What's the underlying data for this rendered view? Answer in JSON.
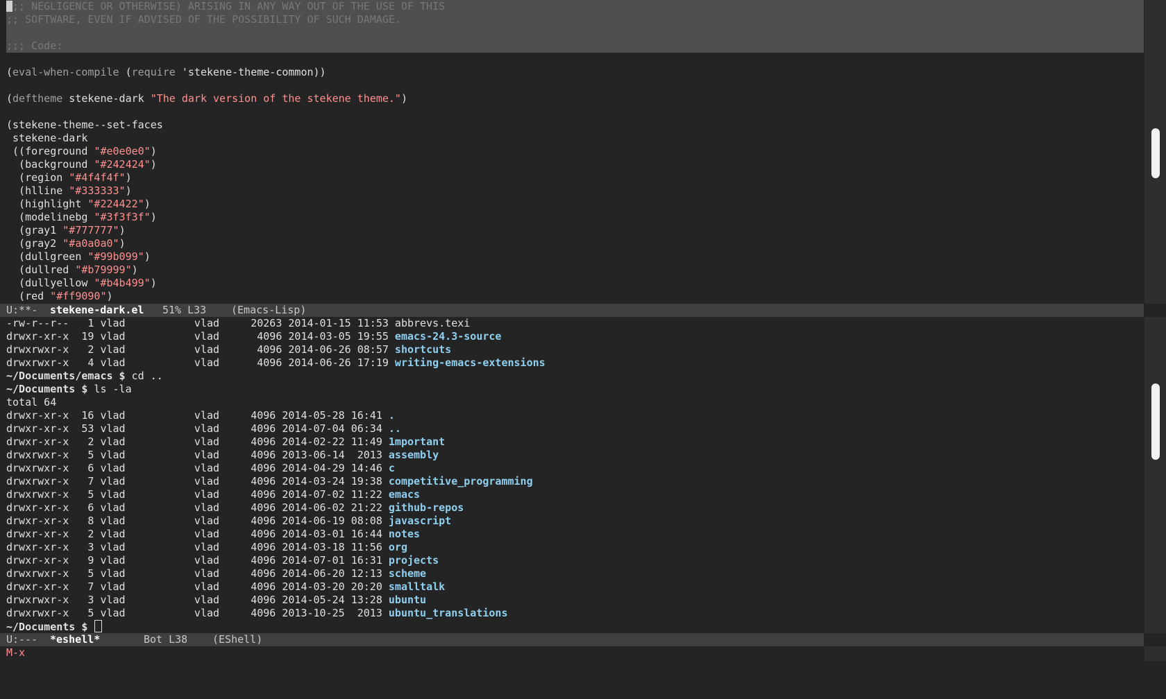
{
  "editor": {
    "comment_lines": [
      ";; NEGLIGENCE OR OTHERWISE) ARISING IN ANY WAY OUT OF THE USE OF THIS",
      ";; SOFTWARE, EVEN IF ADVISED OF THE POSSIBILITY OF SUCH DAMAGE.",
      "",
      ";;; Code:"
    ],
    "eval_line": {
      "pre": "(",
      "kw": "eval-when-compile",
      "mid": " (",
      "kw2": "require",
      "sym": " 'stekene-theme-common",
      "post": "))"
    },
    "deftheme_line": {
      "pre": "(",
      "kw": "deftheme",
      "name": " stekene-dark ",
      "str": "\"The dark version of the stekene theme.\"",
      "post": ")"
    },
    "setfaces_line": "(stekene-theme--set-faces",
    "theme_name_line": " stekene-dark",
    "faces": [
      {
        "prefix": " ((",
        "name": "foreground",
        "value": "\"#e0e0e0\"",
        "suffix": ")"
      },
      {
        "prefix": "  (",
        "name": "background",
        "value": "\"#242424\"",
        "suffix": ")"
      },
      {
        "prefix": "  (",
        "name": "region",
        "value": "\"#4f4f4f\"",
        "suffix": ")"
      },
      {
        "prefix": "  (",
        "name": "hlline",
        "value": "\"#333333\"",
        "suffix": ")"
      },
      {
        "prefix": "  (",
        "name": "highlight",
        "value": "\"#224422\"",
        "suffix": ")"
      },
      {
        "prefix": "  (",
        "name": "modelinebg",
        "value": "\"#3f3f3f\"",
        "suffix": ")"
      },
      {
        "prefix": "  (",
        "name": "gray1",
        "value": "\"#777777\"",
        "suffix": ")"
      },
      {
        "prefix": "  (",
        "name": "gray2",
        "value": "\"#a0a0a0\"",
        "suffix": ")"
      },
      {
        "prefix": "  (",
        "name": "dullgreen",
        "value": "\"#99b099\"",
        "suffix": ")"
      },
      {
        "prefix": "  (",
        "name": "dullred",
        "value": "\"#b79999\"",
        "suffix": ")"
      },
      {
        "prefix": "  (",
        "name": "dullyellow",
        "value": "\"#b4b499\"",
        "suffix": ")"
      },
      {
        "prefix": "  (",
        "name": "red",
        "value": "\"#ff9090\"",
        "suffix": ")"
      }
    ]
  },
  "modeline_top": {
    "status": "U:**-",
    "buffer": "stekene-dark.el",
    "pos": "51% L33",
    "mode": "(Emacs-Lisp)"
  },
  "shell": {
    "first_listing": [
      {
        "meta": "-rw-r--r--   1 vlad           vlad     20263 2014-01-15 11:53 ",
        "name": "abbrevs.texi",
        "dir": false
      },
      {
        "meta": "drwxr-xr-x  19 vlad           vlad      4096 2014-03-05 19:55 ",
        "name": "emacs-24.3-source",
        "dir": true
      },
      {
        "meta": "drwxrwxr-x   2 vlad           vlad      4096 2014-06-26 08:57 ",
        "name": "shortcuts",
        "dir": true
      },
      {
        "meta": "drwxrwxr-x   4 vlad           vlad      4096 2014-06-26 17:19 ",
        "name": "writing-emacs-extensions",
        "dir": true
      }
    ],
    "cmd1": {
      "prompt": "~/Documents/emacs $",
      "command": " cd .."
    },
    "cmd2": {
      "prompt": "~/Documents $",
      "command": " ls -la"
    },
    "total": "total 64",
    "second_listing": [
      {
        "meta": "drwxr-xr-x  16 vlad           vlad     4096 2014-05-28 16:41 ",
        "name": ".",
        "dir": true
      },
      {
        "meta": "drwxr-xr-x  53 vlad           vlad     4096 2014-07-04 06:34 ",
        "name": "..",
        "dir": true
      },
      {
        "meta": "drwxr-xr-x   2 vlad           vlad     4096 2014-02-22 11:49 ",
        "name": "1mportant",
        "dir": true
      },
      {
        "meta": "drwxrwxr-x   5 vlad           vlad     4096 2013-06-14  2013 ",
        "name": "assembly",
        "dir": true
      },
      {
        "meta": "drwxrwxr-x   6 vlad           vlad     4096 2014-04-29 14:46 ",
        "name": "c",
        "dir": true
      },
      {
        "meta": "drwxrwxr-x   7 vlad           vlad     4096 2014-03-24 19:38 ",
        "name": "competitive_programming",
        "dir": true
      },
      {
        "meta": "drwxrwxr-x   5 vlad           vlad     4096 2014-07-02 11:22 ",
        "name": "emacs",
        "dir": true
      },
      {
        "meta": "drwxr-xr-x   6 vlad           vlad     4096 2014-06-02 21:22 ",
        "name": "github-repos",
        "dir": true
      },
      {
        "meta": "drwxr-xr-x   8 vlad           vlad     4096 2014-06-19 08:08 ",
        "name": "javascript",
        "dir": true
      },
      {
        "meta": "drwxr-xr-x   2 vlad           vlad     4096 2014-03-01 16:44 ",
        "name": "notes",
        "dir": true
      },
      {
        "meta": "drwxr-xr-x   3 vlad           vlad     4096 2014-03-18 11:56 ",
        "name": "org",
        "dir": true
      },
      {
        "meta": "drwxr-xr-x   9 vlad           vlad     4096 2014-07-01 16:31 ",
        "name": "projects",
        "dir": true
      },
      {
        "meta": "drwxrwxr-x   5 vlad           vlad     4096 2014-06-20 12:13 ",
        "name": "scheme",
        "dir": true
      },
      {
        "meta": "drwxr-xr-x   7 vlad           vlad     4096 2014-03-20 20:20 ",
        "name": "smalltalk",
        "dir": true
      },
      {
        "meta": "drwxrwxr-x   3 vlad           vlad     4096 2014-05-24 13:28 ",
        "name": "ubuntu",
        "dir": true
      },
      {
        "meta": "drwxrwxr-x   5 vlad           vlad     4096 2013-10-25  2013 ",
        "name": "ubuntu_translations",
        "dir": true
      }
    ],
    "final_prompt": "~/Documents $"
  },
  "modeline_bottom": {
    "status": "U:---",
    "buffer": "*eshell*",
    "pos": "Bot L38",
    "mode": "(EShell)"
  },
  "minibuffer": "M-x",
  "colors": {
    "background": "#242424",
    "foreground": "#e0e0e0",
    "region": "#4f4f4f",
    "modelinebg": "#3f3f3f",
    "gray1": "#777777",
    "string": "#ff9090",
    "directory": "#8fd0f0"
  }
}
